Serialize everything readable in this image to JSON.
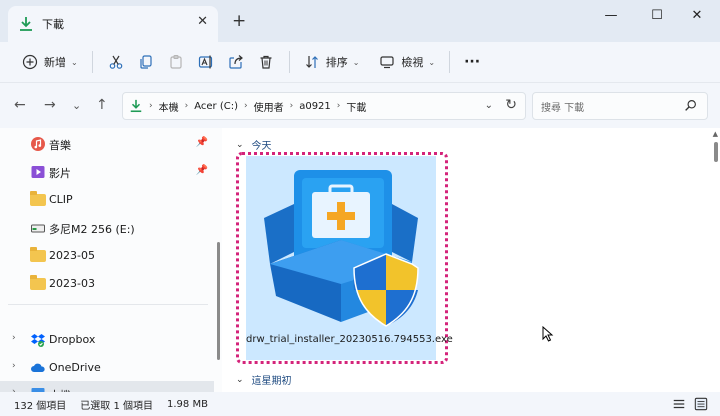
{
  "window": {
    "tab_title": "下載",
    "new_tab": "+",
    "minimize": "—",
    "maximize": "☐",
    "close": "✕"
  },
  "toolbar": {
    "new_label": "新增",
    "sort_label": "排序",
    "view_label": "檢視",
    "more": "···"
  },
  "nav": {
    "breadcrumbs": [
      "本機",
      "Acer (C:)",
      "使用者",
      "a0921",
      "下載"
    ],
    "search_placeholder": "搜尋 下載"
  },
  "sidebar": {
    "items": [
      {
        "label": "音樂",
        "icon": "music-icon",
        "pinned": true
      },
      {
        "label": "影片",
        "icon": "video-icon",
        "pinned": true
      },
      {
        "label": "CLIP",
        "icon": "folder-icon"
      },
      {
        "label": "多尼M2 256 (E:)",
        "icon": "drive-icon"
      },
      {
        "label": "2023-05",
        "icon": "folder-icon"
      },
      {
        "label": "2023-03",
        "icon": "folder-icon"
      },
      {
        "label": "Dropbox",
        "icon": "dropbox-icon"
      },
      {
        "label": "OneDrive",
        "icon": "onedrive-icon"
      },
      {
        "label": "本機",
        "icon": "pc-icon"
      }
    ]
  },
  "content": {
    "group_today": "今天",
    "group_earlier": "這星期初",
    "file_name": "drw_trial_installer_20230516.794553.exe"
  },
  "status": {
    "item_count": "132 個項目",
    "selected": "已選取 1 個項目",
    "size": "1.98 MB"
  },
  "colors": {
    "selection_bg": "#cce8ff",
    "highlight_outline": "#d4237a",
    "accent": "#0067c0"
  }
}
